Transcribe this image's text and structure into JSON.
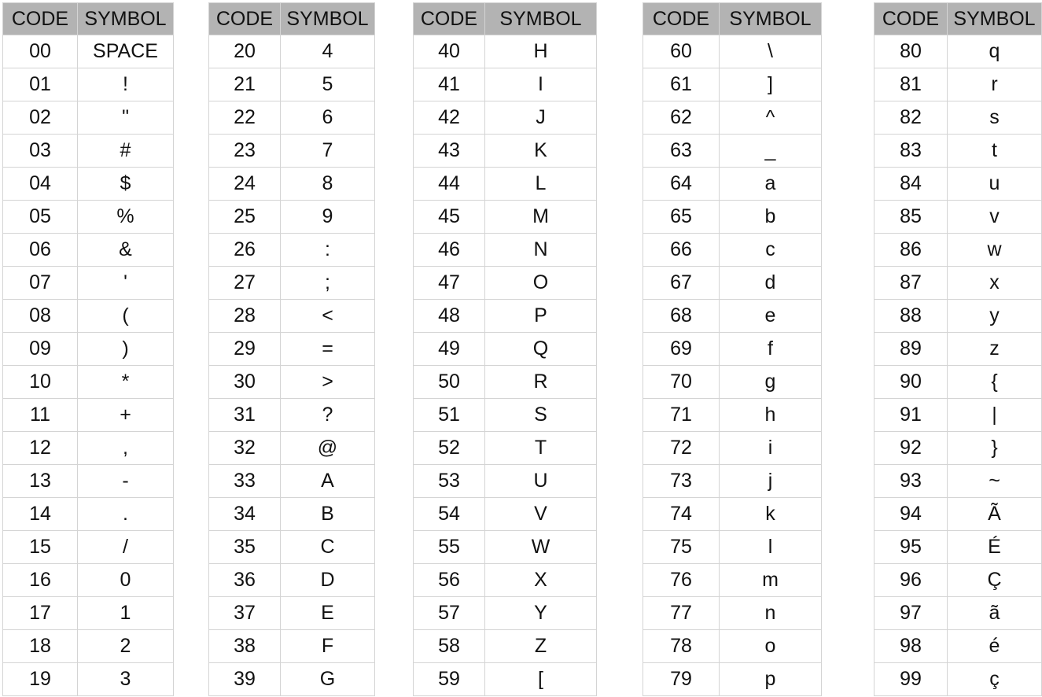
{
  "headers": {
    "code": "CODE",
    "symbol": "SYMBOL"
  },
  "tables": [
    {
      "rows": [
        [
          "00",
          "SPACE"
        ],
        [
          "01",
          "!"
        ],
        [
          "02",
          "\""
        ],
        [
          "03",
          "#"
        ],
        [
          "04",
          "$"
        ],
        [
          "05",
          "%"
        ],
        [
          "06",
          "&"
        ],
        [
          "07",
          "'"
        ],
        [
          "08",
          "("
        ],
        [
          "09",
          ")"
        ],
        [
          "10",
          "*"
        ],
        [
          "11",
          "+"
        ],
        [
          "12",
          ","
        ],
        [
          "13",
          "-"
        ],
        [
          "14",
          "."
        ],
        [
          "15",
          "/"
        ],
        [
          "16",
          "0"
        ],
        [
          "17",
          "1"
        ],
        [
          "18",
          "2"
        ],
        [
          "19",
          "3"
        ]
      ]
    },
    {
      "rows": [
        [
          "20",
          "4"
        ],
        [
          "21",
          "5"
        ],
        [
          "22",
          "6"
        ],
        [
          "23",
          "7"
        ],
        [
          "24",
          "8"
        ],
        [
          "25",
          "9"
        ],
        [
          "26",
          ":"
        ],
        [
          "27",
          ";"
        ],
        [
          "28",
          "<"
        ],
        [
          "29",
          "="
        ],
        [
          "30",
          ">"
        ],
        [
          "31",
          "?"
        ],
        [
          "32",
          "@"
        ],
        [
          "33",
          "A"
        ],
        [
          "34",
          "B"
        ],
        [
          "35",
          "C"
        ],
        [
          "36",
          "D"
        ],
        [
          "37",
          "E"
        ],
        [
          "38",
          "F"
        ],
        [
          "39",
          "G"
        ]
      ]
    },
    {
      "rows": [
        [
          "40",
          "H"
        ],
        [
          "41",
          "I"
        ],
        [
          "42",
          "J"
        ],
        [
          "43",
          "K"
        ],
        [
          "44",
          "L"
        ],
        [
          "45",
          "M"
        ],
        [
          "46",
          "N"
        ],
        [
          "47",
          "O"
        ],
        [
          "48",
          "P"
        ],
        [
          "49",
          "Q"
        ],
        [
          "50",
          "R"
        ],
        [
          "51",
          "S"
        ],
        [
          "52",
          "T"
        ],
        [
          "53",
          "U"
        ],
        [
          "54",
          "V"
        ],
        [
          "55",
          "W"
        ],
        [
          "56",
          "X"
        ],
        [
          "57",
          "Y"
        ],
        [
          "58",
          "Z"
        ],
        [
          "59",
          "["
        ]
      ]
    },
    {
      "rows": [
        [
          "60",
          "\\"
        ],
        [
          "61",
          "]"
        ],
        [
          "62",
          "^"
        ],
        [
          "63",
          "_"
        ],
        [
          "64",
          "a"
        ],
        [
          "65",
          "b"
        ],
        [
          "66",
          "c"
        ],
        [
          "67",
          "d"
        ],
        [
          "68",
          "e"
        ],
        [
          "69",
          "f"
        ],
        [
          "70",
          "g"
        ],
        [
          "71",
          "h"
        ],
        [
          "72",
          "i"
        ],
        [
          "73",
          "j"
        ],
        [
          "74",
          "k"
        ],
        [
          "75",
          "l"
        ],
        [
          "76",
          "m"
        ],
        [
          "77",
          "n"
        ],
        [
          "78",
          "o"
        ],
        [
          "79",
          "p"
        ]
      ]
    },
    {
      "rows": [
        [
          "80",
          "q"
        ],
        [
          "81",
          "r"
        ],
        [
          "82",
          "s"
        ],
        [
          "83",
          "t"
        ],
        [
          "84",
          "u"
        ],
        [
          "85",
          "v"
        ],
        [
          "86",
          "w"
        ],
        [
          "87",
          "x"
        ],
        [
          "88",
          "y"
        ],
        [
          "89",
          "z"
        ],
        [
          "90",
          "{"
        ],
        [
          "91",
          "|"
        ],
        [
          "92",
          "}"
        ],
        [
          "93",
          "~"
        ],
        [
          "94",
          "Ã"
        ],
        [
          "95",
          "É"
        ],
        [
          "96",
          "Ç"
        ],
        [
          "97",
          "ã"
        ],
        [
          "98",
          "é"
        ],
        [
          "99",
          "ç"
        ]
      ]
    }
  ]
}
